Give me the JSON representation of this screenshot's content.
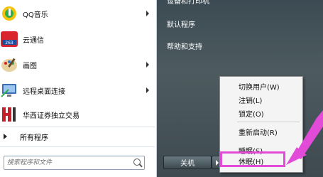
{
  "left_pane": {
    "items": [
      {
        "label": "QQ音乐",
        "has_submenu": true
      },
      {
        "label": "云通信",
        "has_submenu": false
      },
      {
        "label": "画图",
        "has_submenu": true
      },
      {
        "label": "远程桌面连接",
        "has_submenu": true
      },
      {
        "label": "华西证券独立交易",
        "has_submenu": false
      }
    ],
    "all_programs": "所有程序",
    "search_placeholder": "搜索程序和文件"
  },
  "right_pane": {
    "top_partial": "设备和打印机",
    "links": [
      "默认程序",
      "帮助和支持"
    ],
    "shutdown_label": "关机"
  },
  "power_menu": {
    "items": [
      "切换用户(W)",
      "注销(L)",
      "锁定(O)",
      "重新启动(R)",
      "睡眠(S)",
      "休眠(H)"
    ],
    "highlighted": "休眠(H)"
  },
  "colors": {
    "annotation": "#e14bd8",
    "right_pane": "#45535a"
  }
}
